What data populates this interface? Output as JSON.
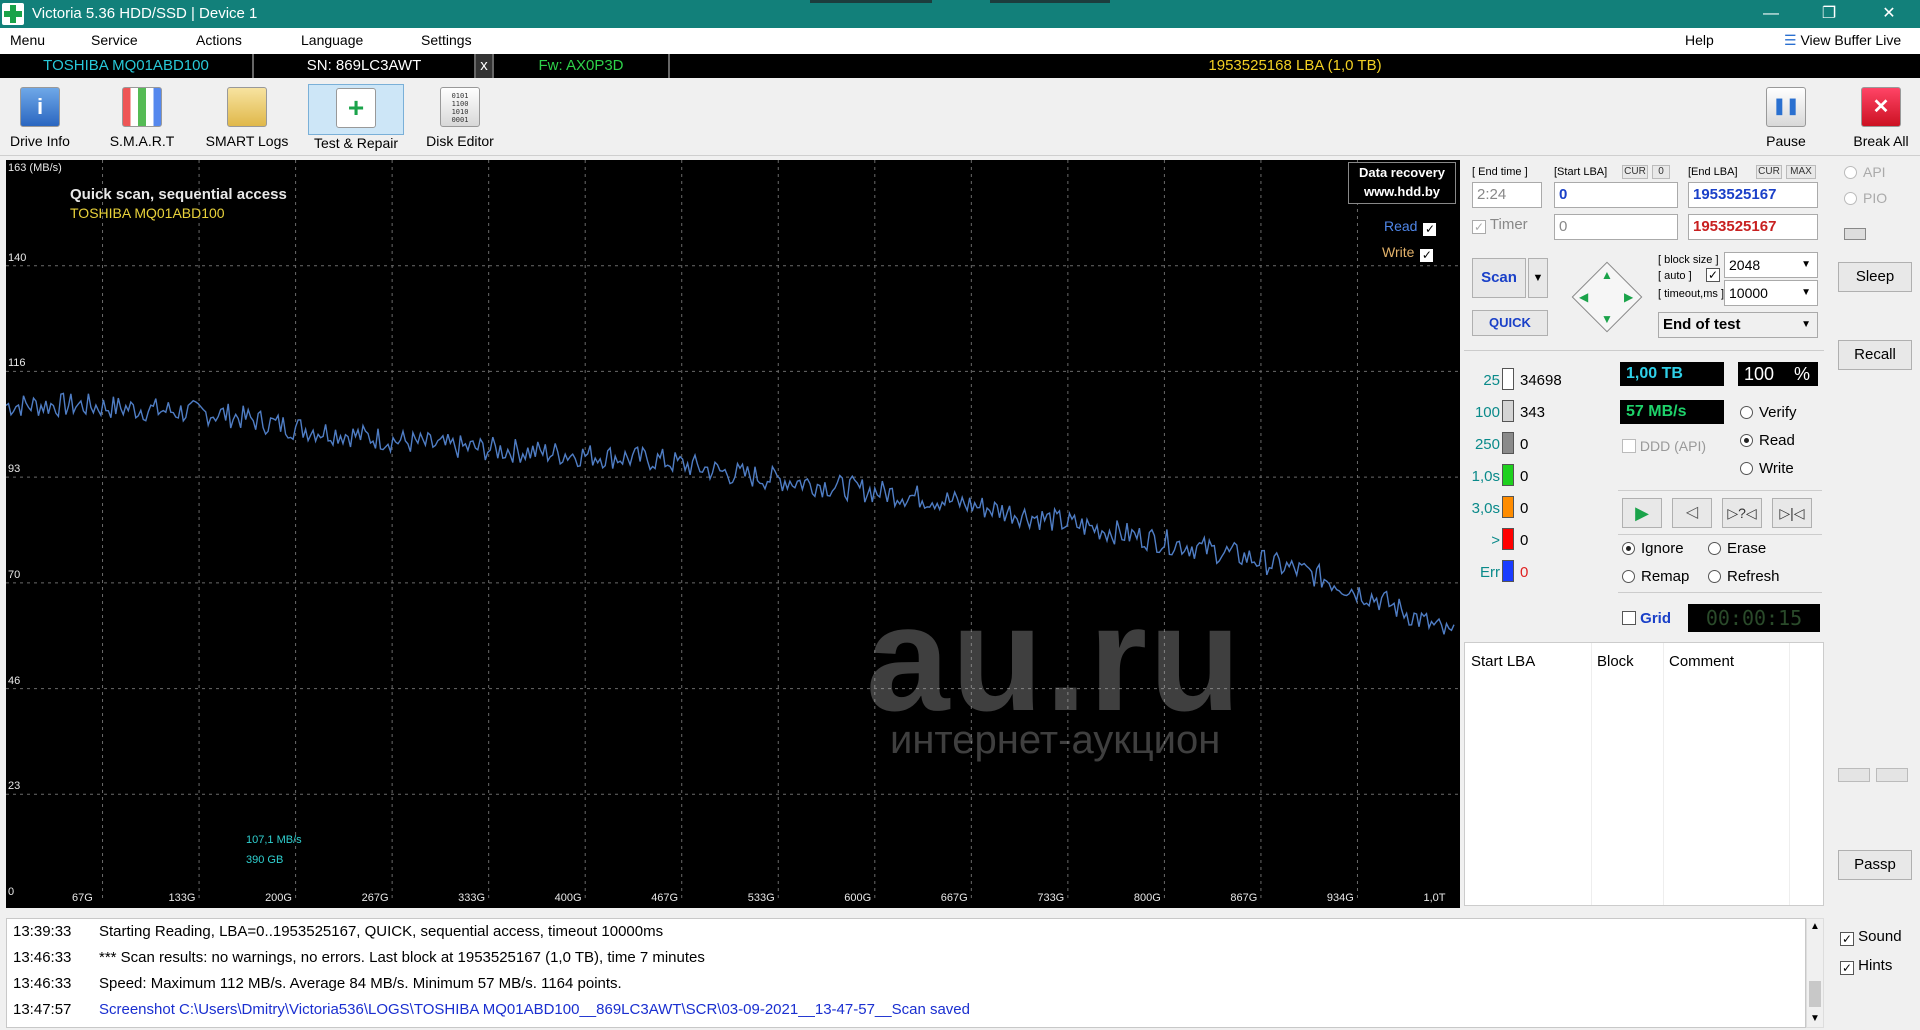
{
  "window": {
    "title": "Victoria 5.36 HDD/SSD | Device 1",
    "controls": [
      "—",
      "❐",
      "✕"
    ]
  },
  "menu": {
    "items": [
      "Menu",
      "Service",
      "Actions",
      "Language",
      "Settings"
    ],
    "help": "Help",
    "view_buffer": "View Buffer Live"
  },
  "infobar": {
    "model": "TOSHIBA MQ01ABD100",
    "serial": "SN: 869LC3AWT",
    "close": "x",
    "firmware": "Fw: AX0P3D",
    "capacity": "1953525168 LBA (1,0 TB)"
  },
  "toolbar": {
    "buttons": [
      "Drive Info",
      "S.M.A.R.T",
      "SMART Logs",
      "Test & Repair",
      "Disk Editor"
    ],
    "pause": "Pause",
    "break_all": "Break All"
  },
  "graph": {
    "title": "Quick scan, sequential access",
    "drive": "TOSHIBA MQ01ABD100",
    "y_unit_label": "163 (MB/s)",
    "y_ticks": [
      "140",
      "116",
      "93",
      "70",
      "46",
      "23",
      "0"
    ],
    "x_ticks": [
      "67G",
      "133G",
      "200G",
      "267G",
      "333G",
      "400G",
      "467G",
      "533G",
      "600G",
      "667G",
      "733G",
      "800G",
      "867G",
      "934G",
      "1,0T"
    ],
    "read_label": "Read",
    "write_label": "Write",
    "promo_line1": "Data recovery",
    "promo_line2": "www.hdd.by",
    "cursor_speed": "107,1 MB/s",
    "cursor_pos": "390 GB",
    "watermark": "au.ru",
    "watermark_sub": "интернет-аукцион",
    "line_color": "#4f7dc4"
  },
  "chart_data": {
    "type": "line",
    "title": "Quick scan, sequential access",
    "xlabel": "",
    "ylabel": "(MB/s)",
    "ylim": [
      0,
      163
    ],
    "xlim": [
      0,
      1000
    ],
    "x_unit": "GB",
    "grid": true,
    "series": [
      {
        "name": "Read",
        "x": [
          0,
          50,
          100,
          150,
          200,
          250,
          300,
          350,
          400,
          450,
          500,
          550,
          600,
          650,
          700,
          750,
          800,
          850,
          900,
          950,
          1000
        ],
        "values": [
          109,
          109,
          108,
          107,
          104,
          102,
          100,
          99,
          98,
          97,
          94,
          92,
          90,
          88,
          85,
          82,
          79,
          76,
          72,
          66,
          58
        ]
      }
    ]
  },
  "controls": {
    "end_time_label": "[ End time ]",
    "start_lba_label": "[Start LBA]",
    "cur_label": "CUR",
    "zero_label": "0",
    "end_lba_label": "[End LBA]",
    "max_label": "MAX",
    "end_time_value": "2:24",
    "start_lba_value": "0",
    "end_lba_value": "1953525167",
    "timer_label": "Timer",
    "timer_value": "0",
    "end_lba_value2": "1953525167",
    "block_size_label": "[ block size ]",
    "auto_label": "[ auto ]",
    "block_size_value": "2048",
    "timeout_label": "[ timeout,ms ]",
    "timeout_value": "10000",
    "scan_button": "Scan",
    "quick_button": "QUICK",
    "end_of_test": "End of test"
  },
  "stats": {
    "rows": [
      {
        "label": "25",
        "count": "34698",
        "color": "#ffffff",
        "label_color": "#0a8a8a"
      },
      {
        "label": "100",
        "count": "343",
        "color": "#d4d4d4",
        "label_color": "#0a8a8a"
      },
      {
        "label": "250",
        "count": "0",
        "color": "#8a8a8a",
        "label_color": "#0a8a8a"
      },
      {
        "label": "1,0s",
        "count": "0",
        "color": "#1fd11f",
        "label_color": "#0a8a8a"
      },
      {
        "label": "3,0s",
        "count": "0",
        "color": "#ff8c00",
        "label_color": "#0a8a8a"
      },
      {
        "label": ">",
        "count": "0",
        "color": "#ff0000",
        "label_color": "#0a8a8a"
      },
      {
        "label": "Err",
        "count": "0",
        "color": "#1a3cff",
        "label_color": "#0a8a8a"
      }
    ],
    "size_done": "1,00 TB",
    "percent": "100",
    "percent_sign": "%",
    "speed": "57 MB/s",
    "ddd_label": "DDD (API)",
    "mode_verify": "Verify",
    "mode_read": "Read",
    "mode_write": "Write",
    "ignore": "Ignore",
    "erase": "Erase",
    "remap": "Remap",
    "refresh": "Refresh",
    "grid": "Grid",
    "timer_display": "00:00:15"
  },
  "table": {
    "columns": [
      "Start LBA",
      "Block",
      "Comment"
    ]
  },
  "right": {
    "api": "API",
    "pio": "PIO",
    "sleep": "Sleep",
    "recall": "Recall",
    "passp": "Passp",
    "sound": "Sound",
    "hints": "Hints"
  },
  "log": [
    {
      "time": "13:39:33",
      "text": "Starting Reading, LBA=0..1953525167, QUICK, sequential access, timeout 10000ms",
      "color": "#000000"
    },
    {
      "time": "13:46:33",
      "text": "*** Scan results: no warnings, no errors. Last block at 1953525167 (1,0 TB), time 7 minutes",
      "color": "#000000"
    },
    {
      "time": "13:46:33",
      "text": "Speed: Maximum 112 MB/s. Average 84 MB/s. Minimum 57 MB/s. 1164 points.",
      "color": "#000000"
    },
    {
      "time": "13:47:57",
      "text": "Screenshot C:\\Users\\Dmitry\\Victoria536\\LOGS\\TOSHIBA MQ01ABD100__869LC3AWT\\SCR\\03-09-2021__13-47-57__Scan saved",
      "color": "#1a2fd0"
    }
  ]
}
